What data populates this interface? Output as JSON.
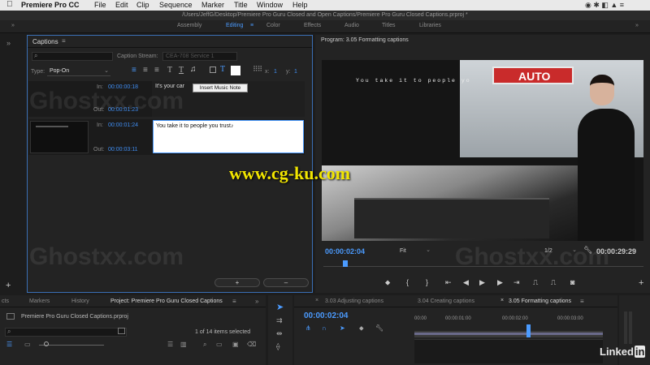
{
  "menubar": {
    "app_name": "Premiere Pro CC",
    "items": [
      "File",
      "Edit",
      "Clip",
      "Sequence",
      "Marker",
      "Title",
      "Window",
      "Help"
    ]
  },
  "window_title": "/Users/JeffG/Desktop/Premiere Pro Guru Closed and Open Captions/Premiere Pro Guru Closed Captions.prproj *",
  "workspaces": [
    "Assembly",
    "Editing",
    "Color",
    "Effects",
    "Audio",
    "Titles",
    "Libraries"
  ],
  "captions_panel": {
    "title": "Captions",
    "stream_label": "Caption Stream:",
    "stream_value": "CEA-708 Service 1",
    "type_label": "Type:",
    "type_value": "Pop-On",
    "x_label": "x:",
    "x_value": "1",
    "y_label": "y:",
    "y_value": "1",
    "tooltip": "Insert Music Note",
    "rows": [
      {
        "in_label": "In:",
        "in_tc": "00:00:00:18",
        "out_label": "Out:",
        "out_tc": "00:00:01:23",
        "text": "It's your car"
      },
      {
        "in_label": "In:",
        "in_tc": "00:00:01:24",
        "out_label": "Out:",
        "out_tc": "00:00:03:11",
        "text": "You take it to people you trust♪"
      }
    ],
    "add_label": "+",
    "remove_label": "–"
  },
  "program_monitor": {
    "title": "Program: 3.05 Formatting captions",
    "caption_overlay": "You take it to people yo",
    "sign_text": "AUTO",
    "timecode": "00:00:02:04",
    "fit_value": "Fit",
    "resolution_value": "1/2",
    "duration": "00:00:29:29"
  },
  "bottom_tabs": [
    "cts",
    "Markers",
    "History",
    "Project: Premiere Pro Guru Closed Captions"
  ],
  "project_panel": {
    "file_name": "Premiere Pro Guru Closed Captions.prproj",
    "items_selected": "1 of 14 items selected"
  },
  "timeline": {
    "tabs": [
      "3.03 Adjusting captions",
      "3.04 Creating captions",
      "3.05 Formatting captions"
    ],
    "timecode": "00:00:02:04",
    "ruler": [
      "00:00",
      "00:00:01:00",
      "00:00:02:00",
      "00:00:03:00"
    ]
  },
  "watermarks": [
    "Ghostxx.com",
    "www.cg-ku.com"
  ],
  "brand": "Linked",
  "brand_in": "in"
}
